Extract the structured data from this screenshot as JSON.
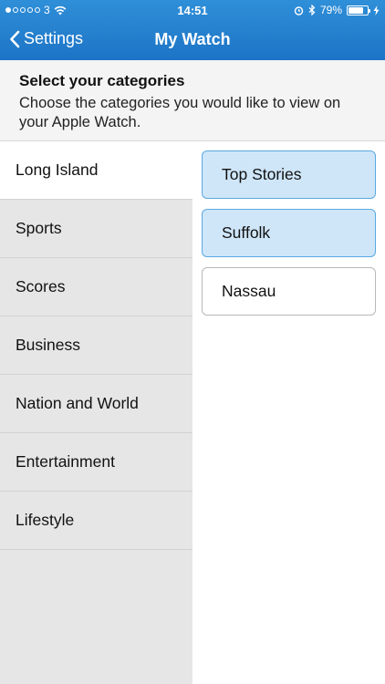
{
  "status": {
    "carrier": "3",
    "time": "14:51",
    "battery_percent": "79%",
    "battery_level": 0.79
  },
  "nav": {
    "back_label": "Settings",
    "title": "My Watch"
  },
  "header": {
    "title": "Select your categories",
    "description": "Choose the categories you would like to view on your Apple Watch."
  },
  "categories": [
    {
      "label": "Long Island",
      "selected": true
    },
    {
      "label": "Sports"
    },
    {
      "label": "Scores"
    },
    {
      "label": "Business"
    },
    {
      "label": "Nation and World"
    },
    {
      "label": "Entertainment"
    },
    {
      "label": "Lifestyle"
    }
  ],
  "subcategories": [
    {
      "label": "Top Stories",
      "selected": true
    },
    {
      "label": "Suffolk",
      "selected": true
    },
    {
      "label": "Nassau",
      "selected": false
    }
  ],
  "colors": {
    "nav_bar": "#1d74c6",
    "selected_chip": "#cfe6f9",
    "chip_border": "#5aa8e0"
  }
}
